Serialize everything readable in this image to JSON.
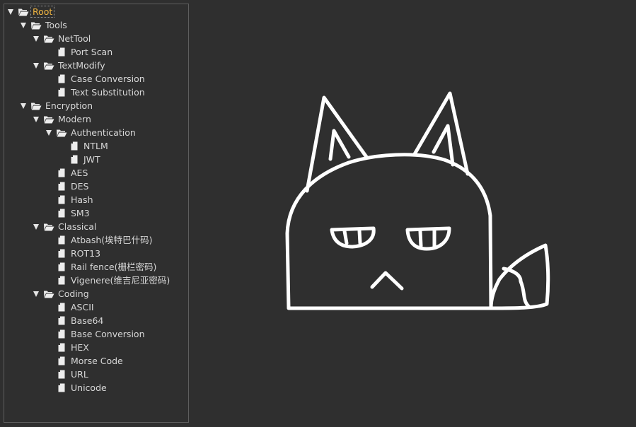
{
  "tree": {
    "selected_color": "#f0b541",
    "items": [
      {
        "label": "Root",
        "depth": 0,
        "type": "folder",
        "expanded": true,
        "selected": true
      },
      {
        "label": "Tools",
        "depth": 1,
        "type": "folder",
        "expanded": true
      },
      {
        "label": "NetTool",
        "depth": 2,
        "type": "folder",
        "expanded": true
      },
      {
        "label": "Port Scan",
        "depth": 3,
        "type": "file"
      },
      {
        "label": "TextModify",
        "depth": 2,
        "type": "folder",
        "expanded": true
      },
      {
        "label": "Case Conversion",
        "depth": 3,
        "type": "file"
      },
      {
        "label": "Text Substitution",
        "depth": 3,
        "type": "file"
      },
      {
        "label": "Encryption",
        "depth": 1,
        "type": "folder",
        "expanded": true
      },
      {
        "label": "Modern",
        "depth": 2,
        "type": "folder",
        "expanded": true
      },
      {
        "label": "Authentication",
        "depth": 3,
        "type": "folder",
        "expanded": true
      },
      {
        "label": "NTLM",
        "depth": 4,
        "type": "file"
      },
      {
        "label": "JWT",
        "depth": 4,
        "type": "file"
      },
      {
        "label": "AES",
        "depth": 3,
        "type": "file"
      },
      {
        "label": "DES",
        "depth": 3,
        "type": "file"
      },
      {
        "label": "Hash",
        "depth": 3,
        "type": "file"
      },
      {
        "label": "SM3",
        "depth": 3,
        "type": "file"
      },
      {
        "label": "Classical",
        "depth": 2,
        "type": "folder",
        "expanded": true
      },
      {
        "label": "Atbash(埃特巴什码)",
        "depth": 3,
        "type": "file"
      },
      {
        "label": "ROT13",
        "depth": 3,
        "type": "file"
      },
      {
        "label": "Rail fence(栅栏密码)",
        "depth": 3,
        "type": "file"
      },
      {
        "label": "Vigenere(维吉尼亚密码)",
        "depth": 3,
        "type": "file"
      },
      {
        "label": "Coding",
        "depth": 2,
        "type": "folder",
        "expanded": true
      },
      {
        "label": "ASCII",
        "depth": 3,
        "type": "file"
      },
      {
        "label": "Base64",
        "depth": 3,
        "type": "file"
      },
      {
        "label": "Base Conversion",
        "depth": 3,
        "type": "file"
      },
      {
        "label": "HEX",
        "depth": 3,
        "type": "file"
      },
      {
        "label": "Morse Code",
        "depth": 3,
        "type": "file"
      },
      {
        "label": "URL",
        "depth": 3,
        "type": "file"
      },
      {
        "label": "Unicode",
        "depth": 3,
        "type": "file"
      }
    ]
  },
  "canvas": {
    "drawing": "cat-mascot-icon",
    "stroke_color": "#ffffff",
    "background": "#2f2f2f"
  }
}
